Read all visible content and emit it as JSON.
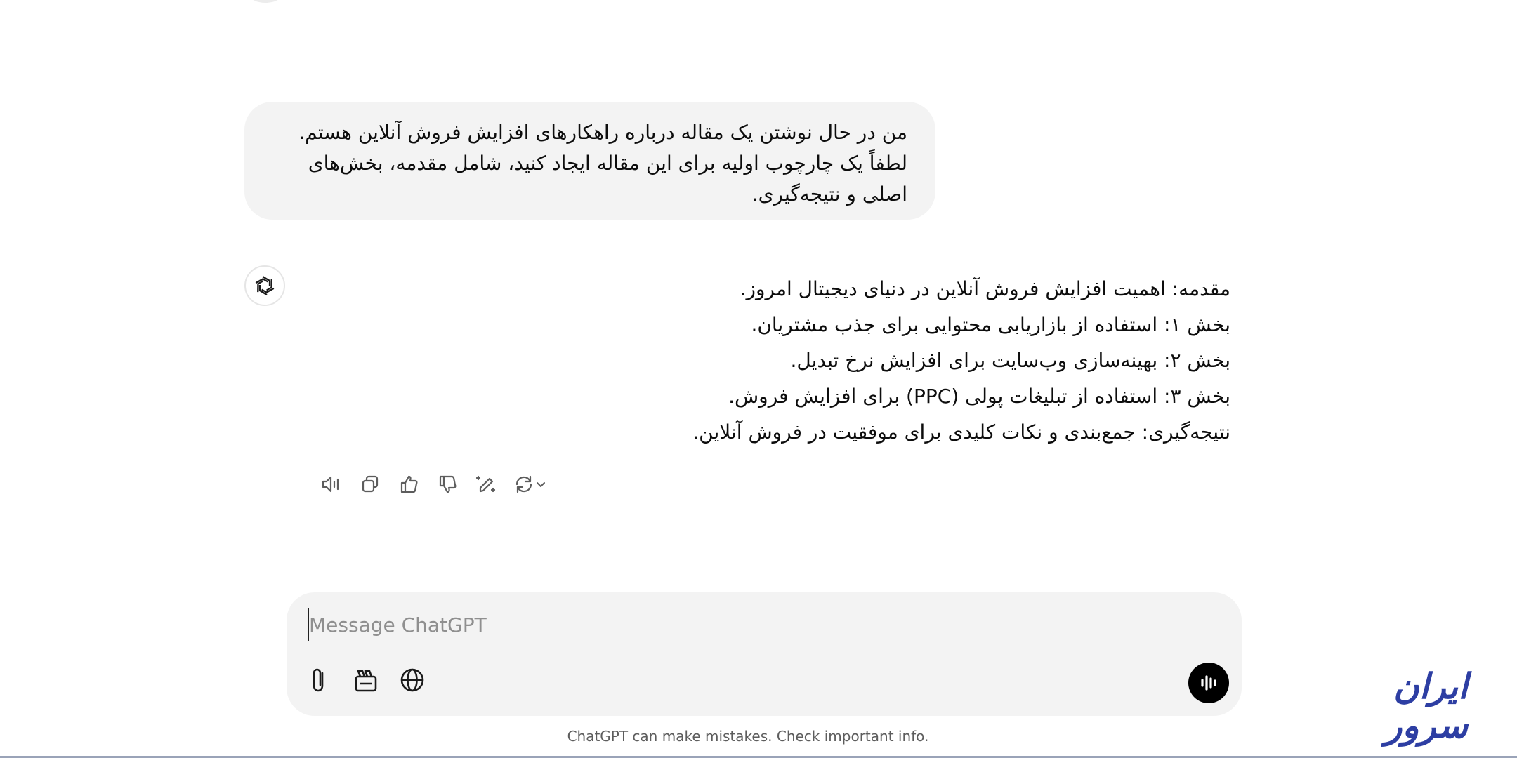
{
  "user_message": {
    "lines": [
      "من در حال نوشتن یک مقاله درباره راهکارهای افزایش فروش آنلاین هستم.",
      "لطفاً یک چارچوب اولیه برای این مقاله ایجاد کنید، شامل مقدمه، بخش‌های",
      "اصلی و نتیجه‌گیری."
    ]
  },
  "assistant_message": {
    "lines": [
      "مقدمه: اهمیت افزایش فروش آنلاین در دنیای دیجیتال امروز.",
      "بخش ۱: استفاده از بازاریابی محتوایی برای جذب مشتریان.",
      "بخش ۲: بهینه‌سازی وب‌سایت برای افزایش نرخ تبدیل.",
      "بخش ۳: استفاده از تبلیغات پولی (PPC) برای افزایش فروش.",
      "نتیجه‌گیری: جمع‌بندی و نکات کلیدی برای موفقیت در فروش آنلاین."
    ]
  },
  "action_icons": [
    "read-aloud-icon",
    "copy-icon",
    "thumbs-up-icon",
    "thumbs-down-icon",
    "edit-canvas-icon",
    "regenerate-icon",
    "chevron-down-icon"
  ],
  "composer": {
    "placeholder": "Message ChatGPT",
    "tool_icons": [
      "attach-icon",
      "tools-icon",
      "globe-icon",
      "voice-mode-icon"
    ]
  },
  "disclaimer": "ChatGPT can make mistakes. Check important info.",
  "watermark": {
    "text": "ایران سرور"
  },
  "colors": {
    "bubble_bg": "#f3f3f3",
    "composer_bg": "#f3f3f3",
    "logo": "#2d3ea3",
    "text": "#0d0d0d",
    "muted": "#5d5d5d"
  }
}
